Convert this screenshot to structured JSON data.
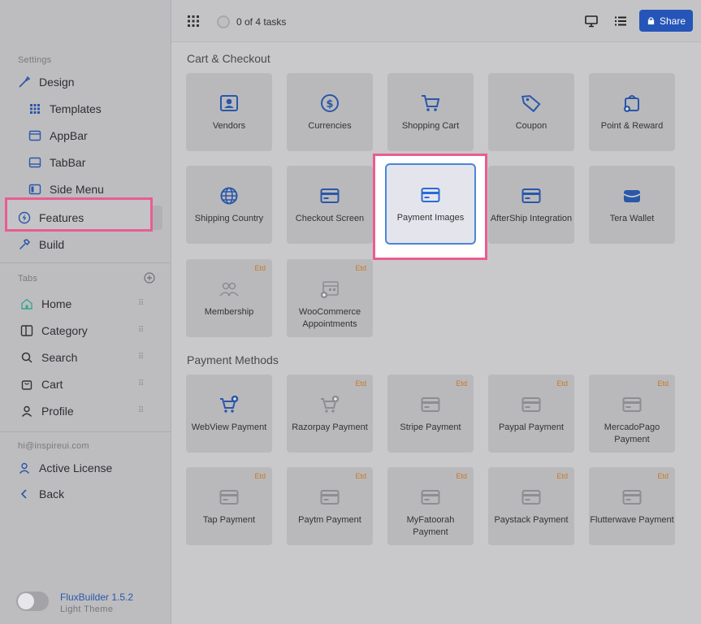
{
  "sidebar": {
    "settings_label": "Settings",
    "design": "Design",
    "templates": "Templates",
    "appbar": "AppBar",
    "tabbar": "TabBar",
    "side_menu": "Side Menu",
    "features": "Features",
    "build": "Build",
    "tabs_label": "Tabs",
    "tabs": [
      "Home",
      "Category",
      "Search",
      "Cart",
      "Profile"
    ],
    "email": "hi@inspireui.com",
    "active_license": "Active License",
    "back": "Back",
    "version": "FluxBuilder 1.5.2",
    "theme": "Light Theme",
    "drag_glyph": "⠿"
  },
  "topbar": {
    "tasks": "0 of 4 tasks",
    "share": "Share"
  },
  "sections": {
    "cart_checkout": "Cart & Checkout",
    "payment_methods": "Payment Methods"
  },
  "cards": {
    "vendors": "Vendors",
    "currencies": "Currencies",
    "shopping_cart": "Shopping Cart",
    "coupon": "Coupon",
    "point_reward": "Point & Reward",
    "shipping_country": "Shipping Country",
    "checkout_screen": "Checkout Screen",
    "payment_images": "Payment Images",
    "aftership": "AfterShip Integration",
    "tera_wallet": "Tera Wallet",
    "membership": "Membership",
    "woo_appointments": "WooCommerce Appointments",
    "webview_payment": "WebView Payment",
    "razorpay": "Razorpay Payment",
    "stripe": "Stripe Payment",
    "paypal": "Paypal Payment",
    "mercadopago": "MercadoPago Payment",
    "tap": "Tap Payment",
    "paytm": "Paytm Payment",
    "myfatoorah": "MyFatoorah Payment",
    "paystack": "Paystack Payment",
    "flutterwave": "Flutterwave Payment",
    "etd": "Etd"
  },
  "colors": {
    "accent": "#2555b8",
    "highlight": "#e95d8f",
    "etd": "#c9781f"
  }
}
